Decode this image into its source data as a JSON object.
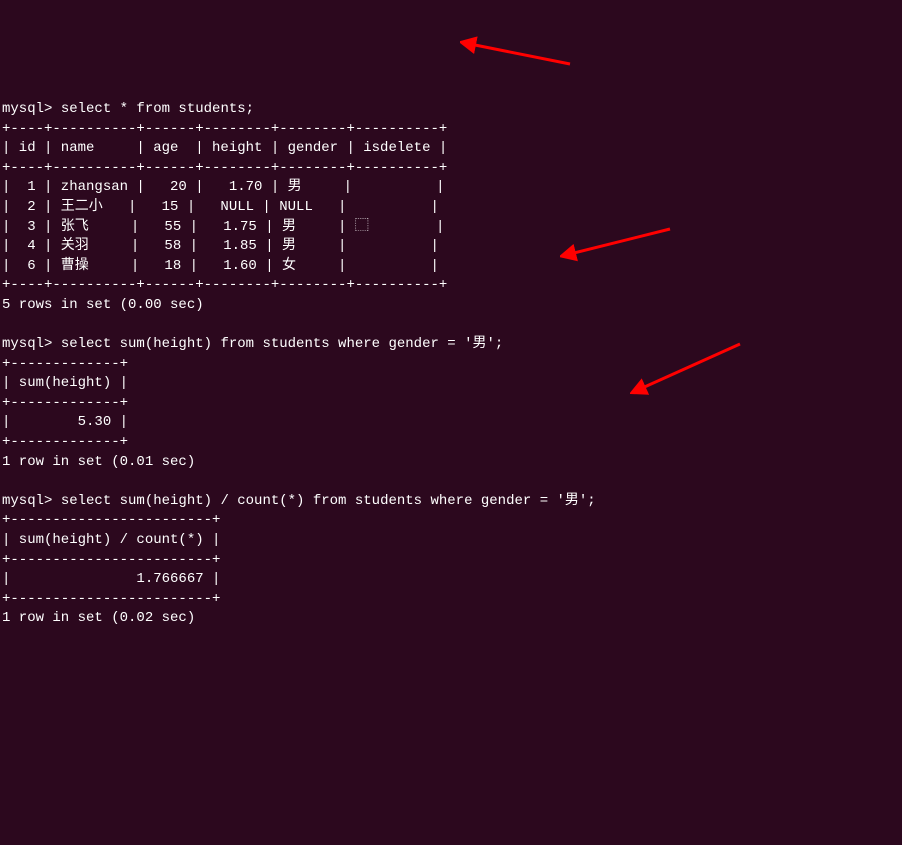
{
  "queries": {
    "q1": {
      "prompt": "mysql> ",
      "sql": "select * from students;",
      "table_top": "+----+----------+------+--------+--------+----------+",
      "table_header": "| id | name     | age  | height | gender | isdelete |",
      "table_sep": "+----+----------+------+--------+--------+----------+",
      "rows": [
        "|  1 | zhangsan |   20 |   1.70 | 男     |          |",
        "|  2 | 王二小   |   15 |   NULL | NULL   |          |",
        "|  3 | 张飞     |   55 |   1.75 | 男     | ⬚        |",
        "|  4 | 关羽     |   58 |   1.85 | 男     |          |",
        "|  6 | 曹操     |   18 |   1.60 | 女     |          |"
      ],
      "table_bottom": "+----+----------+------+--------+--------+----------+",
      "result": "5 rows in set (0.00 sec)"
    },
    "q2": {
      "prompt": "mysql> ",
      "sql": "select sum(height) from students where gender = '男';",
      "table_top": "+-------------+",
      "table_header": "| sum(height) |",
      "table_sep": "+-------------+",
      "rows": [
        "|        5.30 |"
      ],
      "table_bottom": "+-------------+",
      "result": "1 row in set (0.01 sec)"
    },
    "q3": {
      "prompt": "mysql> ",
      "sql": "select sum(height) / count(*) from students where gender = '男';",
      "table_top": "+------------------------+",
      "table_header": "| sum(height) / count(*) |",
      "table_sep": "+------------------------+",
      "rows": [
        "|               1.766667 |"
      ],
      "table_bottom": "+------------------------+",
      "result": "1 row in set (0.02 sec)"
    }
  },
  "chart_data": {
    "type": "table",
    "title": "students",
    "columns": [
      "id",
      "name",
      "age",
      "height",
      "gender",
      "isdelete"
    ],
    "rows": [
      {
        "id": 1,
        "name": "zhangsan",
        "age": 20,
        "height": 1.7,
        "gender": "男",
        "isdelete": ""
      },
      {
        "id": 2,
        "name": "王二小",
        "age": 15,
        "height": null,
        "gender": null,
        "isdelete": ""
      },
      {
        "id": 3,
        "name": "张飞",
        "age": 55,
        "height": 1.75,
        "gender": "男",
        "isdelete": ""
      },
      {
        "id": 4,
        "name": "关羽",
        "age": 58,
        "height": 1.85,
        "gender": "男",
        "isdelete": ""
      },
      {
        "id": 6,
        "name": "曹操",
        "age": 18,
        "height": 1.6,
        "gender": "女",
        "isdelete": ""
      }
    ],
    "aggregates": {
      "sum_height_male": 5.3,
      "avg_height_male": 1.766667
    }
  }
}
